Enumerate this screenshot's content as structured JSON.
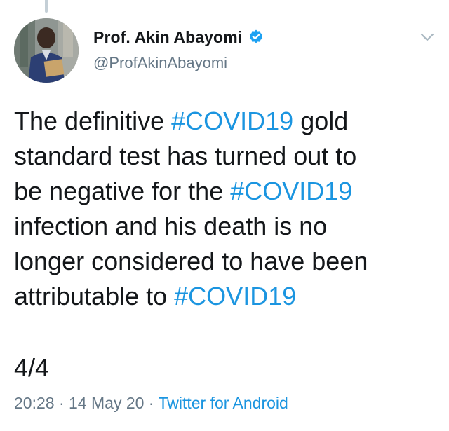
{
  "author": {
    "display_name": "Prof. Akin Abayomi",
    "handle": "@ProfAkinAbayomi",
    "verified": true
  },
  "tweet": {
    "lines": [
      [
        {
          "text": "The definitive ",
          "hashtag": false
        },
        {
          "text": "#COVID19",
          "hashtag": true
        },
        {
          "text": " gold",
          "hashtag": false
        }
      ],
      [
        {
          "text": "standard test has turned out to",
          "hashtag": false
        }
      ],
      [
        {
          "text": "be negative for the ",
          "hashtag": false
        },
        {
          "text": "#COVID19",
          "hashtag": true
        }
      ],
      [
        {
          "text": "infection and his death is no",
          "hashtag": false
        }
      ],
      [
        {
          "text": "longer considered to have been",
          "hashtag": false
        }
      ],
      [
        {
          "text": "attributable to ",
          "hashtag": false
        },
        {
          "text": "#COVID19",
          "hashtag": true
        }
      ]
    ],
    "thread_counter": "4/4"
  },
  "meta": {
    "time": "20:28",
    "separator": " · ",
    "date": "14 May 20",
    "source": "Twitter for Android"
  },
  "icons": {
    "verified": "verified-badge-icon",
    "more": "chevron-down-icon"
  },
  "colors": {
    "hashtag": "#1b95e0",
    "secondary_text": "#657786",
    "verified_badge": "#1da1f2"
  }
}
